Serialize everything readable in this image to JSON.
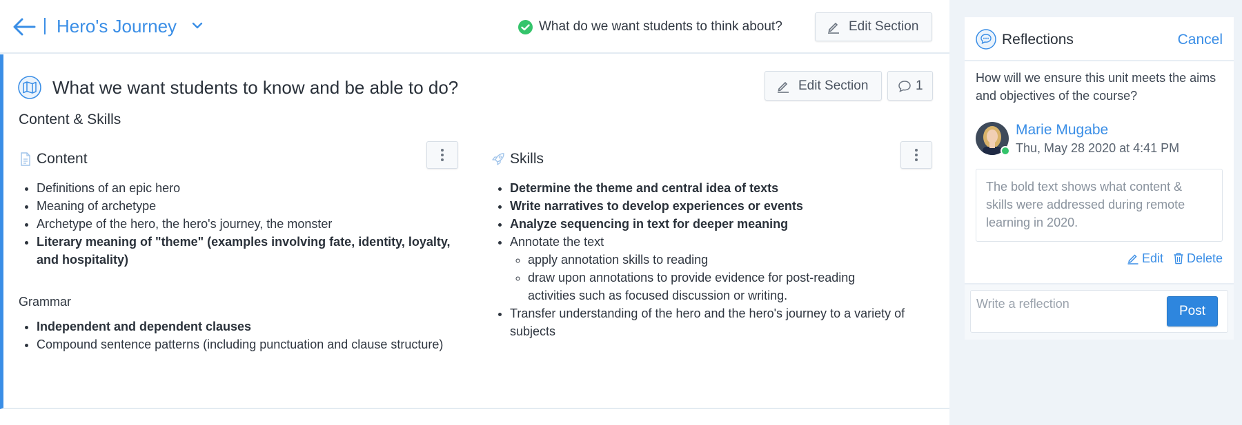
{
  "header": {
    "unit_title": "Hero's Journey",
    "status_text": "What do we want students to think about?",
    "edit_section_label": "Edit Section"
  },
  "section": {
    "heading": "What we want students to know and be able to do?",
    "edit_section_label": "Edit Section",
    "comment_count": "1",
    "sub_heading": "Content & Skills",
    "content": {
      "title": "Content",
      "items": [
        {
          "text": "Definitions of an epic hero",
          "bold": false
        },
        {
          "text": "Meaning of archetype",
          "bold": false
        },
        {
          "text": "Archetype of the hero, the hero's journey, the monster",
          "bold": false
        },
        {
          "text": "Literary meaning of \"theme\" (examples involving fate, identity, loyalty, and hospitality)",
          "bold": true
        }
      ],
      "grammar_label": "Grammar",
      "grammar_items": [
        {
          "text": "Independent and dependent clauses",
          "bold": true
        },
        {
          "text": "Compound sentence patterns (including punctuation and clause structure)",
          "bold": false
        }
      ]
    },
    "skills": {
      "title": "Skills",
      "items": [
        {
          "text": "Determine the theme and central idea of texts",
          "bold": true
        },
        {
          "text": "Write narratives to develop experiences or events",
          "bold": true
        },
        {
          "text": "Analyze sequencing in text for deeper meaning",
          "bold": true
        },
        {
          "text": "Annotate the text",
          "bold": false
        },
        {
          "text": "apply annotation skills to reading",
          "bold": false
        },
        {
          "text": "draw upon annotations to provide evidence for post-reading activities such as focused discussion or writing.",
          "bold": false
        },
        {
          "text": "Transfer understanding of the hero and the hero's journey to a variety of subjects",
          "bold": false
        }
      ]
    }
  },
  "reflections": {
    "title": "Reflections",
    "cancel_label": "Cancel",
    "question": "How will we ensure this unit meets the aims and objectives of the course?",
    "author": "Marie Mugabe",
    "timestamp": "Thu, May 28 2020 at 4:41 PM",
    "body": "The bold text shows what content & skills were addressed during remote learning in 2020.",
    "edit_label": "Edit",
    "delete_label": "Delete",
    "input_placeholder": "Write a reflection",
    "post_label": "Post"
  },
  "colors": {
    "accent": "#3a8ee6",
    "success": "#34c46b",
    "post_button": "#2e86de"
  },
  "icons": [
    "back-arrow-icon",
    "chevron-down-icon",
    "check-circle-icon",
    "pencil-icon",
    "comment-icon",
    "map-icon",
    "document-icon",
    "rocket-icon",
    "kebab-icon",
    "chat-bubble-icon",
    "trash-icon"
  ]
}
